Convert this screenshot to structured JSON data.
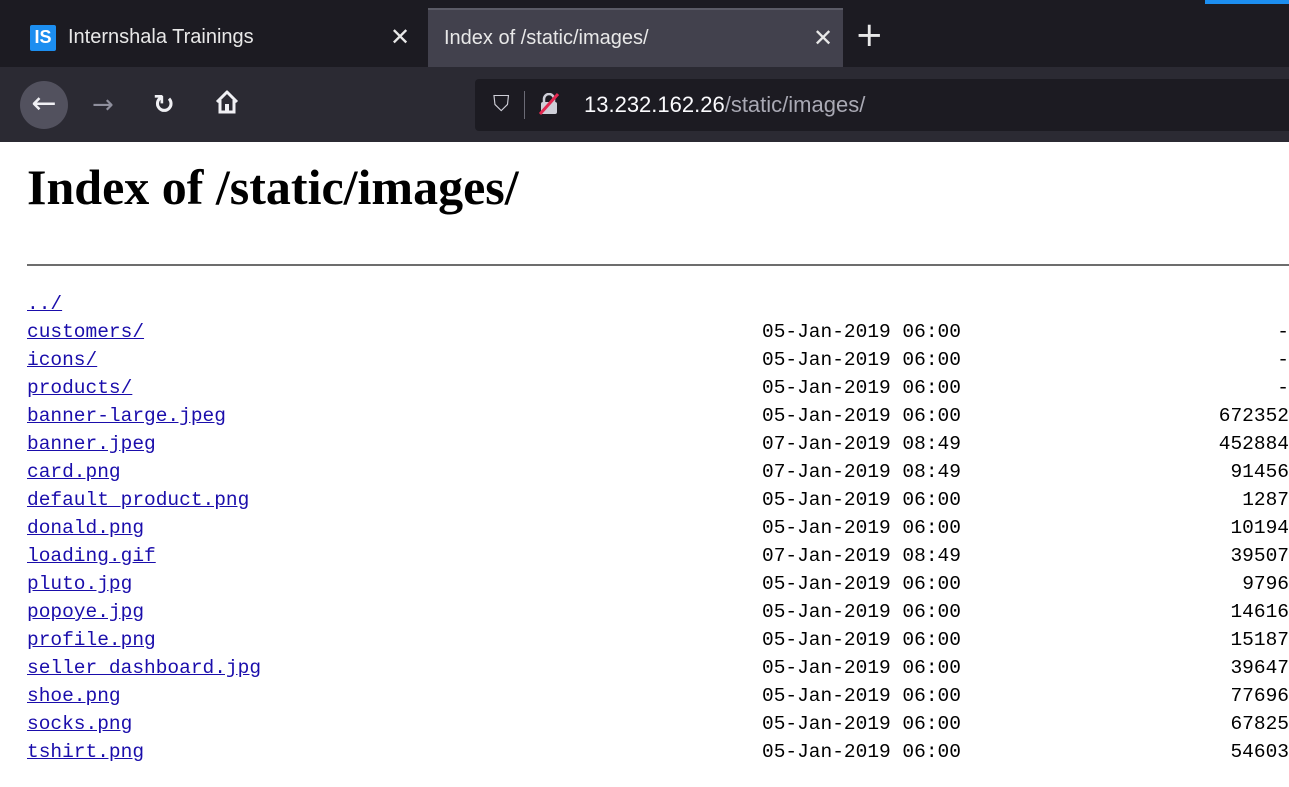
{
  "browser": {
    "tabs": [
      {
        "favicon": "IS",
        "title": "Internshala Trainings",
        "active": false
      },
      {
        "title": "Index of /static/images/",
        "active": true
      }
    ],
    "url": {
      "host": "13.232.162.26",
      "path": "/static/images/"
    },
    "icons": {
      "back": "back-arrow-icon",
      "forward": "forward-arrow-icon",
      "reload": "reload-icon",
      "home": "home-icon",
      "tracking": "shield-icon",
      "security": "insecure-lock-icon",
      "close": "close-icon",
      "new_tab": "plus-icon"
    },
    "accent_color": "#1c8ef0"
  },
  "page": {
    "title": "Index of /static/images/",
    "parent_link": "../",
    "entries": [
      {
        "name": "customers/",
        "date": "05-Jan-2019 06:00",
        "size": "-"
      },
      {
        "name": "icons/",
        "date": "05-Jan-2019 06:00",
        "size": "-"
      },
      {
        "name": "products/",
        "date": "05-Jan-2019 06:00",
        "size": "-"
      },
      {
        "name": "banner-large.jpeg",
        "date": "05-Jan-2019 06:00",
        "size": "672352"
      },
      {
        "name": "banner.jpeg",
        "date": "07-Jan-2019 08:49",
        "size": "452884"
      },
      {
        "name": "card.png",
        "date": "07-Jan-2019 08:49",
        "size": "91456"
      },
      {
        "name": "default_product.png",
        "date": "05-Jan-2019 06:00",
        "size": "1287"
      },
      {
        "name": "donald.png",
        "date": "05-Jan-2019 06:00",
        "size": "10194"
      },
      {
        "name": "loading.gif",
        "date": "07-Jan-2019 08:49",
        "size": "39507"
      },
      {
        "name": "pluto.jpg",
        "date": "05-Jan-2019 06:00",
        "size": "9796"
      },
      {
        "name": "popoye.jpg",
        "date": "05-Jan-2019 06:00",
        "size": "14616"
      },
      {
        "name": "profile.png",
        "date": "05-Jan-2019 06:00",
        "size": "15187"
      },
      {
        "name": "seller_dashboard.jpg",
        "date": "05-Jan-2019 06:00",
        "size": "39647"
      },
      {
        "name": "shoe.png",
        "date": "05-Jan-2019 06:00",
        "size": "77696"
      },
      {
        "name": "socks.png",
        "date": "05-Jan-2019 06:00",
        "size": "67825"
      },
      {
        "name": "tshirt.png",
        "date": "05-Jan-2019 06:00",
        "size": "54603"
      }
    ]
  }
}
